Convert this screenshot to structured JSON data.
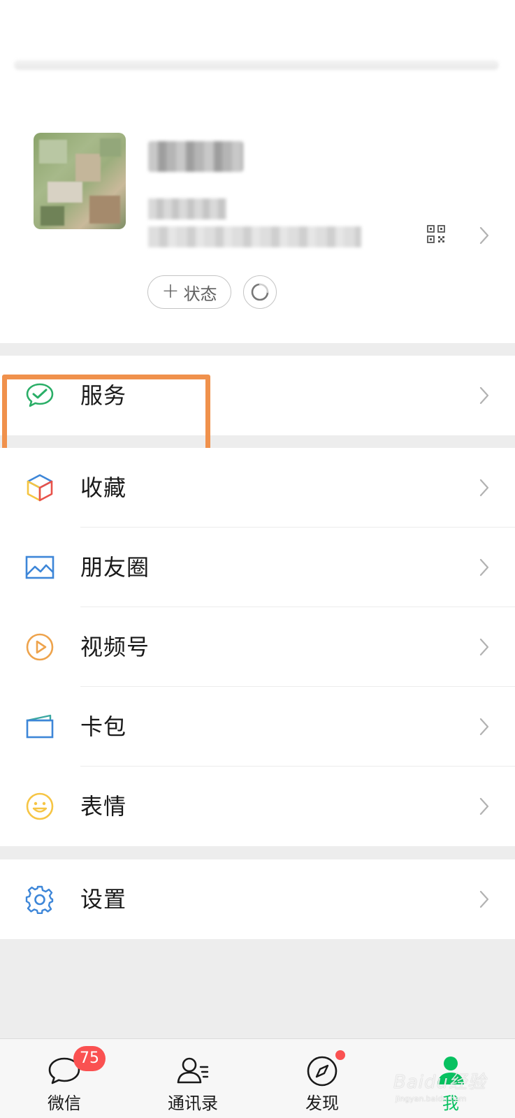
{
  "profile": {
    "status_label": "状态",
    "status_plus": "+"
  },
  "menu": {
    "services": "服务",
    "favorites": "收藏",
    "moments": "朋友圈",
    "channels": "视频号",
    "card_wallet": "卡包",
    "stickers": "表情",
    "settings": "设置"
  },
  "tabbar": {
    "chats": "微信",
    "chats_badge": "75",
    "contacts": "通讯录",
    "discover": "发现",
    "me": "我"
  },
  "watermark": {
    "text": "Baidu经验",
    "sub": "jingyan.baidu.com"
  },
  "colors": {
    "accent_green": "#07c160",
    "badge_red": "#fa5151",
    "highlight_orange": "#f0914c",
    "moments_blue": "#3d86d8",
    "channels_orange": "#eea34c",
    "stickers_yellow": "#f6c544",
    "settings_blue": "#3d86d8"
  },
  "icons": [
    "qr-code-icon",
    "chevron-right-icon",
    "refresh-icon",
    "services-check-icon",
    "favorites-cube-icon",
    "moments-picture-icon",
    "channels-play-icon",
    "card-wallet-icon",
    "stickers-smile-icon",
    "settings-gear-icon",
    "chat-bubble-icon",
    "contacts-person-icon",
    "discover-compass-icon",
    "me-person-icon"
  ]
}
